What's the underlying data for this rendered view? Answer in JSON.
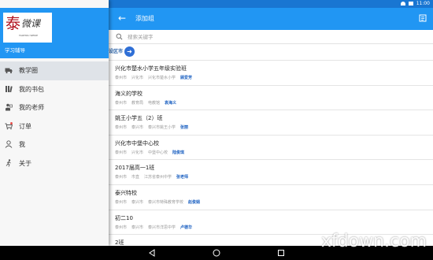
{
  "status_bar": {
    "time": "11:00"
  },
  "app_bar": {
    "back_icon": "arrow-left-icon",
    "title": "添加组",
    "action_icon": "list-icon"
  },
  "search": {
    "placeholder": "搜索关键字"
  },
  "region": {
    "label": "设区市"
  },
  "groups": [
    {
      "name": "兴化市楚水小学五年级实验班",
      "meta": [
        "泰州市",
        "兴化市",
        "兴化市楚水小学"
      ],
      "person": "顾爱芳"
    },
    {
      "name": "海义的学校",
      "meta": [
        "泰州市",
        "教育局",
        "电教馆"
      ],
      "person": "袁海义"
    },
    {
      "name": "姚王小学五（2）班",
      "meta": [
        "泰州市",
        "泰兴市",
        "泰兴市姚王小学"
      ],
      "person": "张丽"
    },
    {
      "name": "兴化市中堡中心校",
      "meta": [
        "泰州市",
        "兴化市",
        "中堡中心校"
      ],
      "person": "陆俊琪"
    },
    {
      "name": "2017届高一1班",
      "meta": [
        "泰州市",
        "市直",
        "江苏省泰州中学"
      ],
      "person": "张老师"
    },
    {
      "name": "泰兴特校",
      "meta": [
        "泰州市",
        "泰兴市",
        "泰兴市特殊教育学校"
      ],
      "person": "赵俊娟"
    },
    {
      "name": "初二10",
      "meta": [
        "泰州市",
        "泰兴市",
        "泰兴市洋思中学"
      ],
      "person": "卢德华"
    },
    {
      "name": "2班",
      "meta": [],
      "person": ""
    }
  ],
  "drawer": {
    "logo_glyph": "泰",
    "logo_text": "微课",
    "logo_subtext": "TAIZHOU WEIKE",
    "caption": "学习辅导",
    "items": [
      {
        "label": "教学圈",
        "icon": "truck-icon",
        "active": true
      },
      {
        "label": "我的书包",
        "icon": "bookshelf-icon",
        "active": false
      },
      {
        "label": "我的老师",
        "icon": "teacher-icon",
        "active": false
      },
      {
        "label": "订单",
        "icon": "cart-icon",
        "active": false
      },
      {
        "label": "我",
        "icon": "person-icon",
        "active": false
      },
      {
        "label": "关于",
        "icon": "run-icon",
        "active": false
      }
    ]
  },
  "watermark": "xfdown.com",
  "colors": {
    "primary": "#2196f3",
    "status": "#1976d2",
    "accent_link": "#1e62c2"
  }
}
